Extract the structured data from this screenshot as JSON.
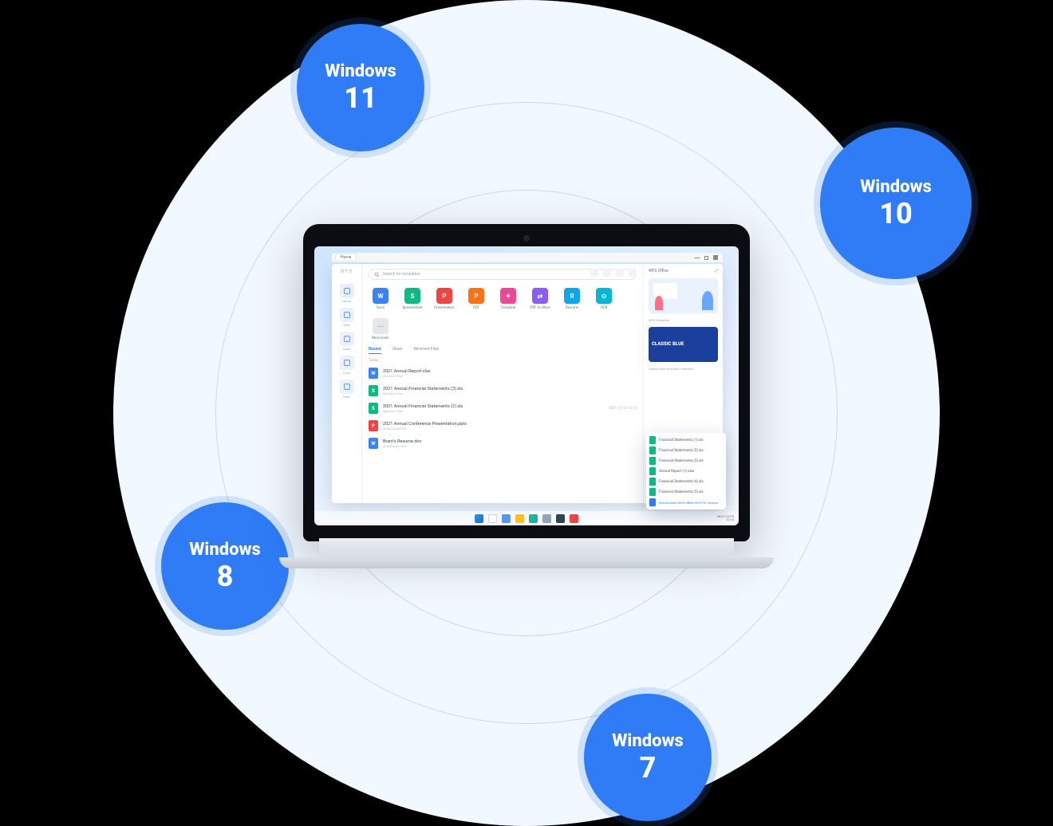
{
  "badges": {
    "w11": {
      "os": "Windows",
      "ver": "11"
    },
    "w10": {
      "os": "Windows",
      "ver": "10"
    },
    "w8": {
      "os": "Windows",
      "ver": "8"
    },
    "w7": {
      "os": "Windows",
      "ver": "7"
    }
  },
  "colors": {
    "badge_bg": "#2f7cf6",
    "ring_bg": "#f2f8ff"
  },
  "app": {
    "logo": "WPS",
    "tab": "Home",
    "search_placeholder": "Search for templates",
    "sidebar": [
      {
        "label": "Home"
      },
      {
        "label": "New"
      },
      {
        "label": "Open"
      },
      {
        "label": "Docs"
      },
      {
        "label": "Team"
      }
    ],
    "create": [
      {
        "label": "Docs",
        "letter": "W",
        "color": "#3b82f6"
      },
      {
        "label": "Spreadsheet",
        "letter": "S",
        "color": "#10b981"
      },
      {
        "label": "Presentation",
        "letter": "P",
        "color": "#ef4444"
      },
      {
        "label": "PDF",
        "letter": "P",
        "color": "#f97316"
      },
      {
        "label": "Template",
        "letter": "✦",
        "color": "#ec4899"
      },
      {
        "label": "PDF to Word",
        "letter": "⇄",
        "color": "#8b5cf6"
      },
      {
        "label": "Resume",
        "letter": "R",
        "color": "#0ea5e9"
      },
      {
        "label": "OCR",
        "letter": "⊙",
        "color": "#06b6d4"
      },
      {
        "label": "More tools",
        "letter": "⋯",
        "color": "#e5e7eb"
      }
    ],
    "section_tabs": {
      "recent": "Recent",
      "share": "Share",
      "received": "Received Files"
    },
    "group_today": "Today",
    "files": [
      {
        "name": "2021 Annual Report.xlsx",
        "sub": "MyCloud Files",
        "date": "",
        "letter": "W",
        "color": "#3b82f6"
      },
      {
        "name": "2021 Annual Financial Statements (3).xls",
        "sub": "MyCloud Files",
        "date": "",
        "letter": "S",
        "color": "#10b981"
      },
      {
        "name": "2021 Annual Financial Statements (2).xls",
        "sub": "MyCloud Files",
        "date": "2021-12-10 10:14",
        "letter": "S",
        "color": "#10b981"
      },
      {
        "name": "2021 Annual Conference Presentation.pptx",
        "sub": "@ MyCloud Files",
        "date": "",
        "letter": "P",
        "color": "#ef4444"
      },
      {
        "name": "Brant's Resume.doc",
        "sub": "@ MyCloud Files",
        "date": "",
        "letter": "W",
        "color": "#3b82f6"
      }
    ],
    "right": {
      "head": "WPS Office",
      "tmpl_cap": "WPS Template",
      "card2_text": "CLASSIC BLUE",
      "card2_cap": "Classic blue template collection"
    },
    "popup_items": [
      "Financial Statements (1).xls",
      "Financial Statements (2).xls",
      "Financial Statements (3).xls",
      "Annual Report (1).xlsx",
      "Financial Statements (4).xls",
      "Financial Statements (5).xls"
    ],
    "popup_link": "Recommend WPS Office 2019 PC Version"
  },
  "taskbar": {
    "date": "2021/12/10",
    "time": "12:10"
  }
}
